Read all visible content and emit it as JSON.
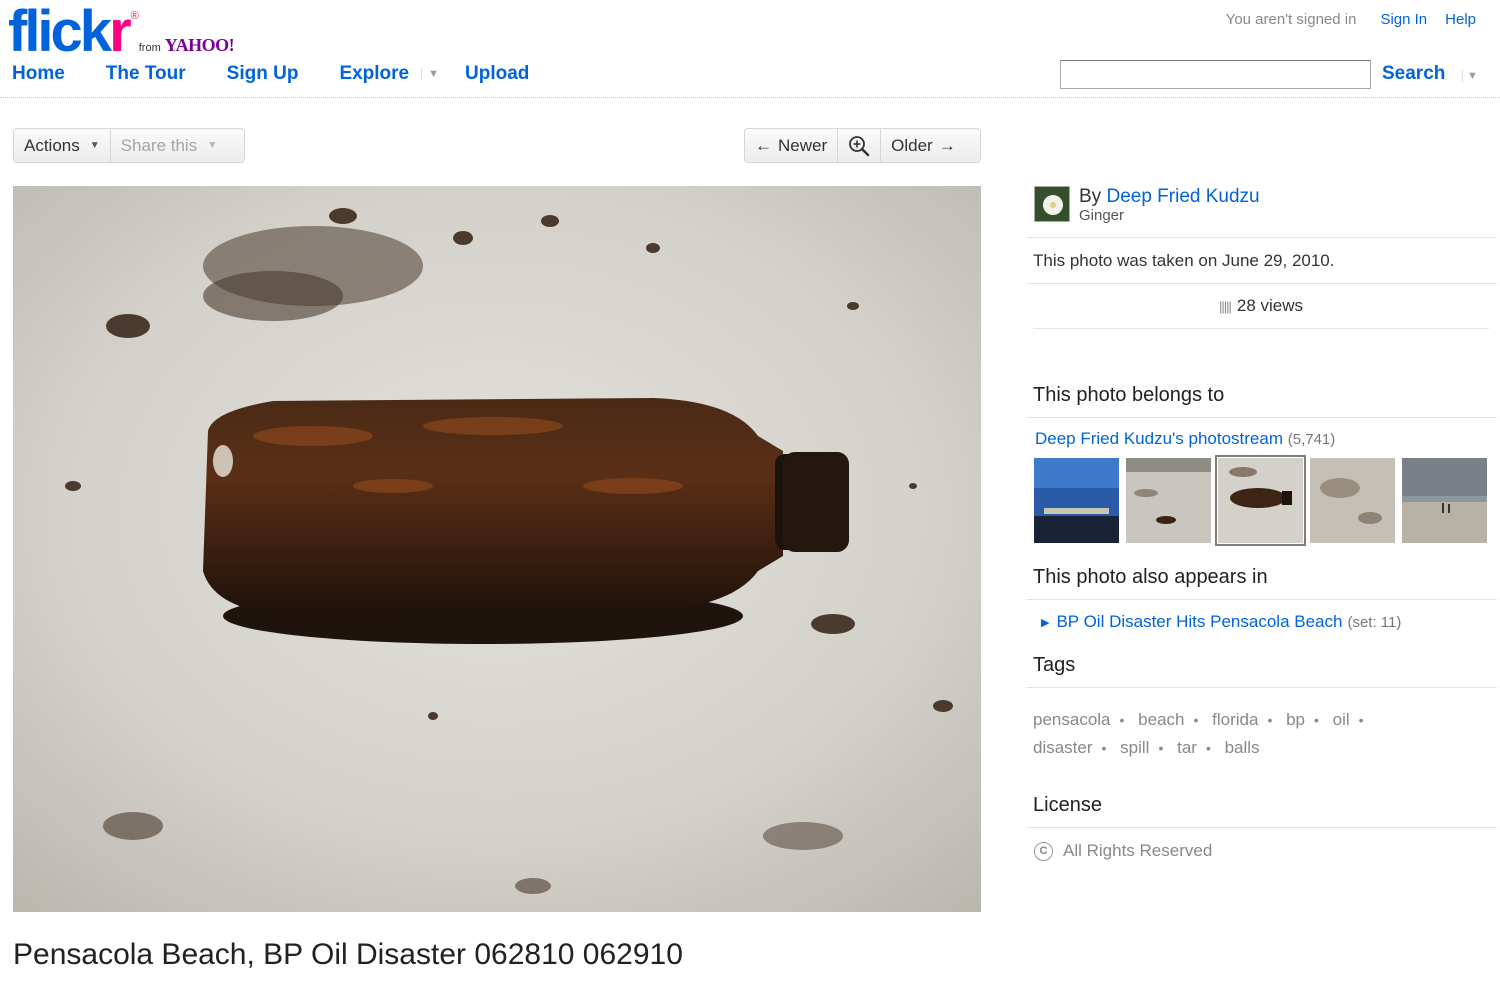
{
  "header": {
    "logo": {
      "word_part1": "flick",
      "word_part2": "r",
      "reg": "®",
      "from": "from",
      "yahoo": "YAHOO!"
    },
    "nav": [
      {
        "label": "Home"
      },
      {
        "label": "The Tour"
      },
      {
        "label": "Sign Up"
      },
      {
        "label": "Explore"
      },
      {
        "label": "Upload"
      }
    ],
    "user": {
      "status": "You aren't signed in",
      "sign_in": "Sign In",
      "help": "Help"
    },
    "search": {
      "value": "",
      "placeholder": "",
      "button": "Search"
    }
  },
  "toolbar": {
    "actions": "Actions",
    "share": "Share this",
    "newer": "Newer",
    "older": "Older"
  },
  "photo": {
    "title": "Pensacola Beach, BP Oil Disaster 062810 062910"
  },
  "sidebar": {
    "owner": {
      "by": "By",
      "name": "Deep Fried Kudzu",
      "real_name": "Ginger"
    },
    "taken": "This photo was taken on June 29, 2010.",
    "views": "28 views",
    "belongs_heading": "This photo belongs to",
    "photostream": {
      "label": "Deep Fried Kudzu's photostream",
      "count": "(5,741)"
    },
    "also_heading": "This photo also appears in",
    "set": {
      "label": "BP Oil Disaster Hits Pensacola Beach",
      "meta": "(set: 11)"
    },
    "tags_heading": "Tags",
    "tags": [
      "pensacola",
      "beach",
      "florida",
      "bp",
      "oil",
      "disaster",
      "spill",
      "tar",
      "balls"
    ],
    "license_heading": "License",
    "license": "All Rights Reserved"
  },
  "colors": {
    "link": "#0063dc",
    "flickr_pink": "#ff0084",
    "yahoo_purple": "#7b0099"
  }
}
